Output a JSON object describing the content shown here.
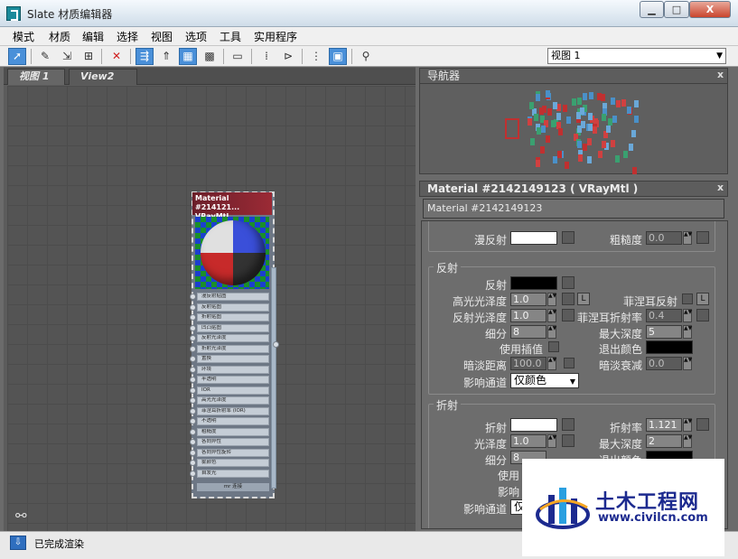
{
  "window": {
    "title": "Slate 材质编辑器",
    "min_label": "▁",
    "max_label": "□",
    "close_label": "X"
  },
  "menu": [
    "模式",
    "材质",
    "编辑",
    "选择",
    "视图",
    "选项",
    "工具",
    "实用程序"
  ],
  "toolbar": {
    "view_select": "视图 1"
  },
  "tabs": [
    "视图 1",
    "View2"
  ],
  "node": {
    "title": "Material #214121...",
    "type": "VRayMtl",
    "slots": [
      "漫反射贴图",
      "反射贴图",
      "折射贴图",
      "凹凸贴图",
      "反射光泽度",
      "折射光泽度",
      "置换",
      "环境",
      "半透明",
      "IOR",
      "高光光泽度",
      "菲涅耳折射率 (IOR)",
      "不透明",
      "粗糙度",
      "各向异性",
      "各向异性旋转",
      "雾颜色",
      "自发光"
    ],
    "footer": "mr 连接"
  },
  "navigator": {
    "title": "导航器",
    "close": "x"
  },
  "material_panel": {
    "title": "Material #2142149123 ( VRayMtl )",
    "close": "x",
    "name_field": "Material #2142149123"
  },
  "basic": {
    "diffuse_label": "漫反射",
    "roughness_label": "粗糙度",
    "roughness_value": "0.0"
  },
  "reflection": {
    "group_label": "反射",
    "reflect_label": "反射",
    "hilight_gloss_label": "高光光泽度",
    "hilight_gloss_value": "1.0",
    "fresnel_label": "菲涅耳反射",
    "l_button": "L",
    "refl_gloss_label": "反射光泽度",
    "refl_gloss_value": "1.0",
    "fresnel_ior_label": "菲涅耳折射率",
    "fresnel_ior_value": "0.4",
    "subdivs_label": "细分",
    "subdivs_value": "8",
    "max_depth_label": "最大深度",
    "max_depth_value": "5",
    "use_interp_label": "使用插值",
    "exit_color_label": "退出颜色",
    "dim_distance_label": "暗淡距离",
    "dim_distance_value": "100.0",
    "dim_falloff_label": "暗淡衰减",
    "dim_falloff_value": "0.0",
    "affect_channels_label": "影响通道",
    "affect_channels_value": "仅颜色"
  },
  "refraction": {
    "group_label": "折射",
    "refract_label": "折射",
    "ior_label": "折射率",
    "ior_value": "1.121",
    "gloss_label": "光泽度",
    "gloss_value": "1.0",
    "max_depth_label": "最大深度",
    "max_depth_value": "2",
    "subdivs_label": "细分",
    "subdivs_value": "8",
    "exit_color_label": "退出颜色",
    "use_label": "使用",
    "affect_label": "影响",
    "affect_channels_label": "影响通道",
    "affect_channels_value": "仅"
  },
  "status": {
    "text": "已完成渲染"
  },
  "watermark": {
    "name": "土木工程网",
    "url": "www.civilcn.com"
  },
  "colors": {
    "accent": "#4a90d9",
    "node_header": "#9b2a35",
    "watermark": "#1c2a8f"
  }
}
